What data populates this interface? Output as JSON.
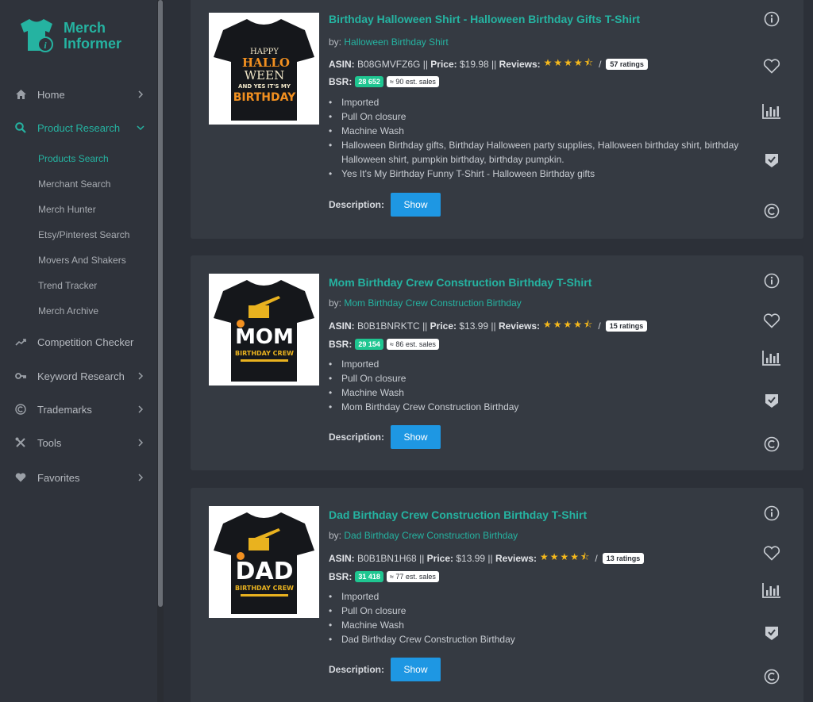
{
  "app": {
    "logo_line1": "Merch",
    "logo_line2": "Informer",
    "accent": "#25b3a1"
  },
  "sidebar": {
    "items": [
      {
        "label": "Home",
        "icon": "home-icon"
      },
      {
        "label": "Product Research",
        "icon": "search-icon",
        "active": true
      },
      {
        "label": "Competition Checker",
        "icon": "trend-icon"
      },
      {
        "label": "Keyword Research",
        "icon": "key-icon"
      },
      {
        "label": "Trademarks",
        "icon": "copyright-icon"
      },
      {
        "label": "Tools",
        "icon": "tools-icon"
      },
      {
        "label": "Favorites",
        "icon": "heart-icon"
      }
    ],
    "subitems": [
      {
        "label": "Products Search",
        "active": true
      },
      {
        "label": "Merchant Search"
      },
      {
        "label": "Merch Hunter"
      },
      {
        "label": "Etsy/Pinterest Search"
      },
      {
        "label": "Movers And Shakers"
      },
      {
        "label": "Trend Tracker"
      },
      {
        "label": "Merch Archive"
      }
    ]
  },
  "labels": {
    "by": "by:",
    "asin": "ASIN:",
    "price": "Price:",
    "reviews": "Reviews:",
    "bsr": "BSR:",
    "description": "Description:",
    "show": "Show",
    "sep": "||",
    "slash": "/"
  },
  "products": [
    {
      "title": "Birthday Halloween Shirt - Halloween Birthday Gifts T-Shirt",
      "brand": "Halloween Birthday Shirt",
      "asin": "B08GMVFZ6G",
      "price": "$19.98",
      "rating": 4.5,
      "stars": "★★★★⯪",
      "ratings": "57 ratings",
      "bsr": "28 652",
      "sales": "≈ 90 est. sales",
      "bullets": [
        "Imported",
        "Pull On closure",
        "Machine Wash",
        "Halloween Birthday gifts, Birthday Halloween party supplies, Halloween birthday shirt, birthday Halloween shirt, pumpkin birthday, birthday pumpkin.",
        "Yes It's My Birthday Funny T-Shirt - Halloween Birthday gifts"
      ],
      "art": {
        "line1": "HAPPY",
        "line2": "HALLO",
        "line3": "WEEN",
        "line4": "AND YES IT'S MY",
        "line5": "BIRTHDAY"
      }
    },
    {
      "title": "Mom Birthday Crew Construction Birthday T-Shirt",
      "brand": "Mom Birthday Crew Construction Birthday",
      "asin": "B0B1BNRKTC",
      "price": "$13.99",
      "rating": 4.5,
      "stars": "★★★★⯪",
      "ratings": "15 ratings",
      "bsr": "29 154",
      "sales": "≈ 86 est. sales",
      "bullets": [
        "Imported",
        "Pull On closure",
        "Machine Wash",
        "Mom Birthday Crew Construction Birthday"
      ],
      "art": {
        "line1": "MOM",
        "line2": "BIRTHDAY CREW"
      }
    },
    {
      "title": "Dad Birthday Crew Construction Birthday T-Shirt",
      "brand": "Dad Birthday Crew Construction Birthday",
      "asin": "B0B1BN1H68",
      "price": "$13.99",
      "rating": 4.5,
      "stars": "★★★★⯪",
      "ratings": "13 ratings",
      "bsr": "31 418",
      "sales": "≈ 77 est. sales",
      "bullets": [
        "Imported",
        "Pull On closure",
        "Machine Wash",
        "Dad Birthday Crew Construction Birthday"
      ],
      "art": {
        "line1": "DAD",
        "line2": "BIRTHDAY CREW"
      }
    }
  ]
}
